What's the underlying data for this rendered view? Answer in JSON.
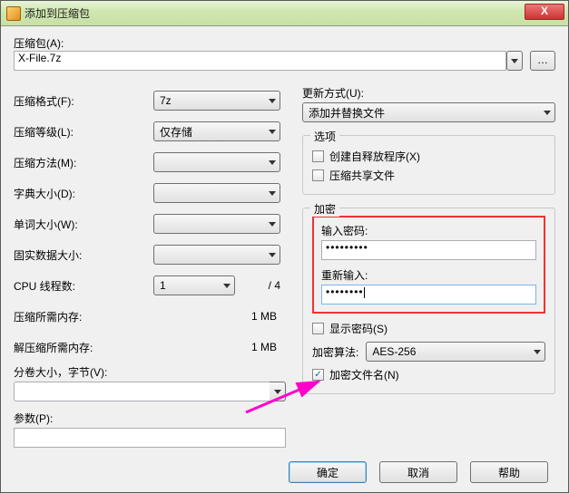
{
  "window": {
    "title": "添加到压缩包",
    "close": "X"
  },
  "archive": {
    "label": "压缩包(A):",
    "value": "X-File.7z",
    "browse": "…"
  },
  "left": {
    "format_label": "压缩格式(F):",
    "format_value": "7z",
    "level_label": "压缩等级(L):",
    "level_value": "仅存储",
    "method_label": "压缩方法(M):",
    "method_value": "",
    "dict_label": "字典大小(D):",
    "dict_value": "",
    "word_label": "单词大小(W):",
    "word_value": "",
    "solid_label": "固实数据大小:",
    "solid_value": "",
    "cpu_label": "CPU 线程数:",
    "cpu_value": "1",
    "cpu_total": "/ 4",
    "mem_comp_label": "压缩所需内存:",
    "mem_comp_value": "1 MB",
    "mem_decomp_label": "解压缩所需内存:",
    "mem_decomp_value": "1 MB",
    "split_label": "分卷大小，字节(V):",
    "split_value": "",
    "params_label": "参数(P):",
    "params_value": ""
  },
  "right": {
    "update_label": "更新方式(U):",
    "update_value": "添加并替换文件",
    "options_legend": "选项",
    "opt_sfx": "创建自释放程序(X)",
    "opt_share": "压缩共享文件",
    "enc_legend": "加密",
    "pw_label": "输入密码:",
    "pw_value": "•••••••••",
    "pw2_label": "重新输入:",
    "pw2_value": "••••••••",
    "show_pw_label": "显示密码(S)",
    "alg_label": "加密算法:",
    "alg_value": "AES-256",
    "enc_names_label": "加密文件名(N)"
  },
  "buttons": {
    "ok": "确定",
    "cancel": "取消",
    "help": "帮助"
  }
}
